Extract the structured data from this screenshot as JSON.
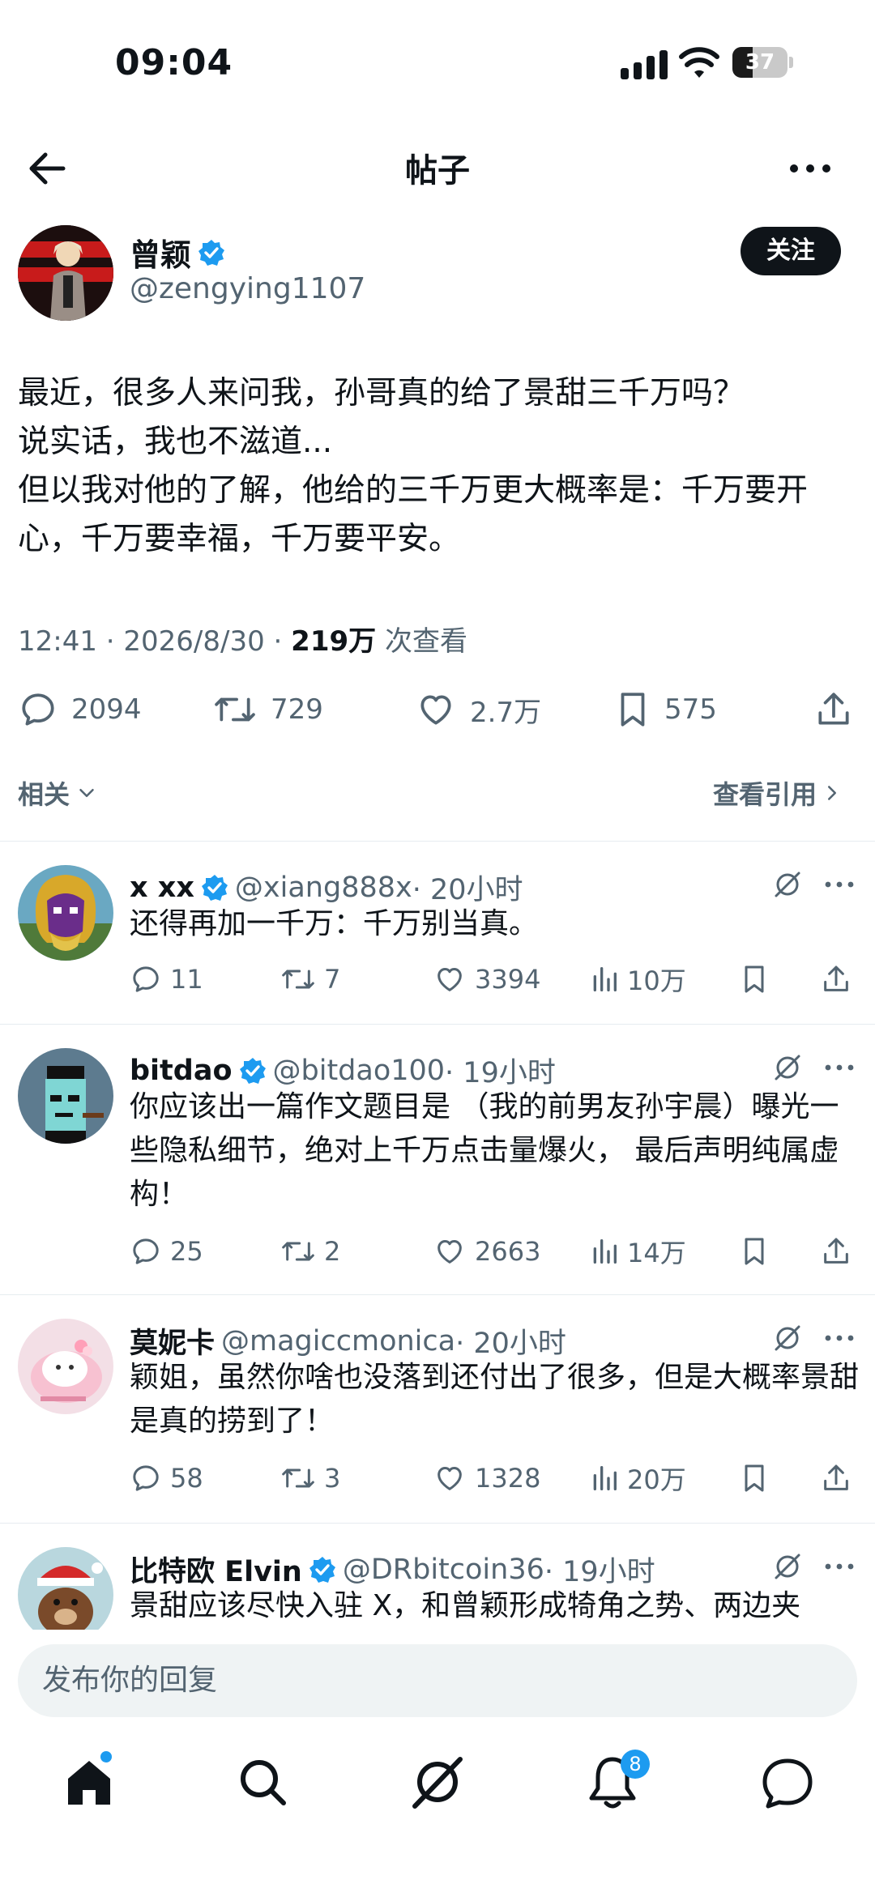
{
  "status_bar": {
    "time": "09:04",
    "battery": "37",
    "battery_level": 0.37
  },
  "header": {
    "title": "帖子"
  },
  "post": {
    "author_name": "曾颖",
    "handle": "@zengying1107",
    "follow_label": "关注",
    "text": "最近，很多人来问我，孙哥真的给了景甜三千万吗？\n说实话，我也不滋道...\n但以我对他的了解，他给的三千万更大概率是：千万要开心，千万要幸福，千万要平安。",
    "timestamp": "12:41 · 2026/8/30 · ",
    "views": "219万",
    "views_label": " 次查看",
    "replies": "2094",
    "reposts": "729",
    "likes": "2.7万",
    "bookmarks": "575"
  },
  "related": {
    "label": "相关",
    "view_quotes": "查看引用"
  },
  "replies": [
    {
      "name": "x xx",
      "handle": "@xiang888x",
      "time": "· 20小时",
      "text": "还得再加一千万：千万别当真。",
      "replies": "11",
      "reposts": "7",
      "likes": "3394",
      "views": "10万"
    },
    {
      "name": "bitdao",
      "handle": "@bitdao100",
      "time": "· 19小时",
      "text": "你应该出一篇作文题目是 （我的前男友孙宇晨）曝光一些隐私细节，绝对上千万点击量爆火， 最后声明纯属虚构！",
      "replies": "25",
      "reposts": "2",
      "likes": "2663",
      "views": "14万"
    },
    {
      "name": "莫妮卡",
      "handle": "@magiccmonica",
      "time": "· 20小时",
      "text": "颖姐，虽然你啥也没落到还付出了很多，但是大概率景甜是真的捞到了！",
      "replies": "58",
      "reposts": "3",
      "likes": "1328",
      "views": "20万"
    },
    {
      "name": "比特欧 Elvin",
      "handle": "@DRbitcoin36",
      "time": "· 19小时",
      "text": "景甜应该尽快入驻 X，和曾颖形成犄角之势、两边夹"
    }
  ],
  "compose": {
    "placeholder": "发布你的回复"
  },
  "tabbar": {
    "notifications_badge": "8"
  },
  "colors": {
    "accent": "#1d9bf0",
    "text": "#0f1419",
    "muted": "#536471"
  }
}
